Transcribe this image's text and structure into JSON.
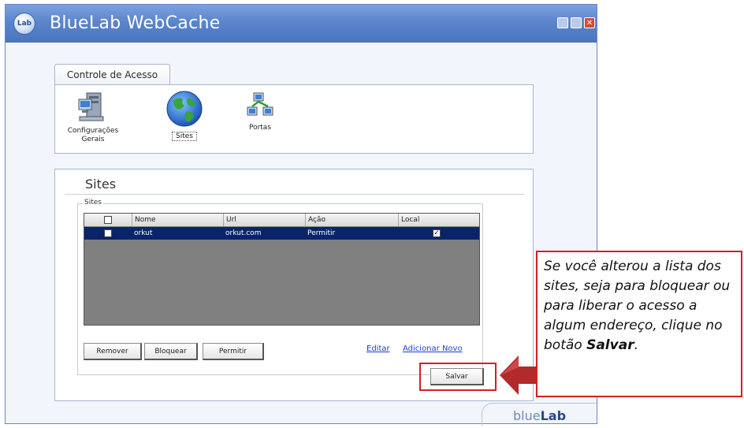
{
  "window": {
    "title": "BlueLab WebCache",
    "app_icon_text": "Lab"
  },
  "tab": {
    "label": "Controle de Acesso"
  },
  "toolbar": {
    "items": [
      {
        "label": "Configurações Gerais",
        "icon": "computer-settings-icon"
      },
      {
        "label": "Sites",
        "icon": "globe-icon"
      },
      {
        "label": "Portas",
        "icon": "network-ports-icon"
      }
    ]
  },
  "sites_panel": {
    "heading": "Sites",
    "group_legend": "Sites",
    "table": {
      "columns": [
        "",
        "Nome",
        "Url",
        "Ação",
        "Local"
      ],
      "rows": [
        {
          "selected": false,
          "nome": "orkut",
          "url": "orkut.com",
          "acao": "Permitir",
          "local": true
        }
      ]
    },
    "buttons": {
      "remover": "Remover",
      "bloquear": "Bloquear",
      "permitir": "Permitir"
    },
    "links": {
      "editar": "Editar",
      "adicionar_novo": "Adicionar Novo"
    },
    "save_label": "Salvar"
  },
  "brand": {
    "logo_light": "blue",
    "logo_bold": "Lab"
  },
  "callout": {
    "text_before": "Se você alterou a lista dos sites, seja para bloquear ou para liberar o acesso a algum endereço, clique no botão ",
    "emphasis": "Salvar",
    "text_after": "."
  },
  "colors": {
    "titlebar": "#5b85cc",
    "selection": "#0a246a",
    "highlight_red": "#d32020",
    "arrow": "#b22a2a"
  }
}
